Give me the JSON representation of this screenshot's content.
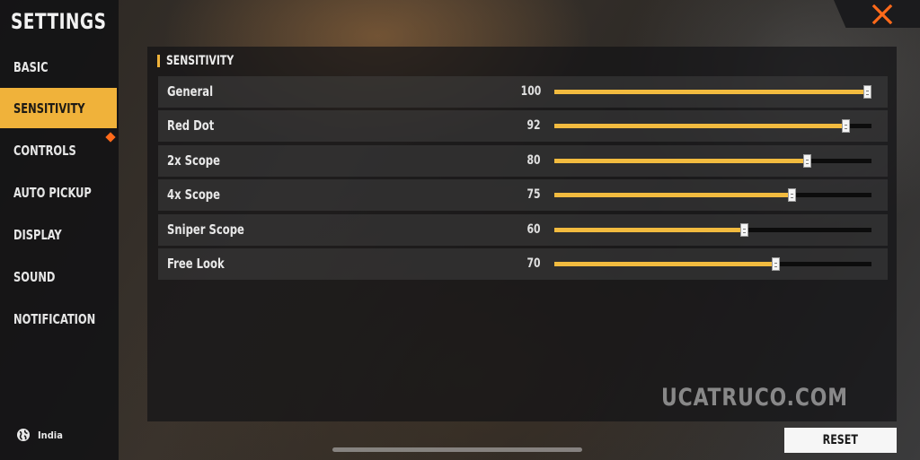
{
  "sidebar": {
    "title": "SETTINGS",
    "items": [
      {
        "label": "BASIC"
      },
      {
        "label": "SENSITIVITY"
      },
      {
        "label": "CONTROLS"
      },
      {
        "label": "AUTO PICKUP"
      },
      {
        "label": "DISPLAY"
      },
      {
        "label": "SOUND"
      },
      {
        "label": "NOTIFICATION"
      }
    ],
    "active_item": "SENSITIVITY",
    "region": "India"
  },
  "section": {
    "title": "SENSITIVITY"
  },
  "sliders": [
    {
      "label": "General",
      "value": 100
    },
    {
      "label": "Red Dot",
      "value": 92
    },
    {
      "label": "2x Scope",
      "value": 80
    },
    {
      "label": "4x Scope",
      "value": 75
    },
    {
      "label": "Sniper Scope",
      "value": 60
    },
    {
      "label": "Free Look",
      "value": 70
    }
  ],
  "watermark": "UCATRUCO.COM",
  "reset_label": "RESET",
  "close_icon": "close-icon",
  "colors": {
    "accent": "#f0b23a",
    "close": "#ff6a1a",
    "reset_bg": "#f6f6f6"
  }
}
